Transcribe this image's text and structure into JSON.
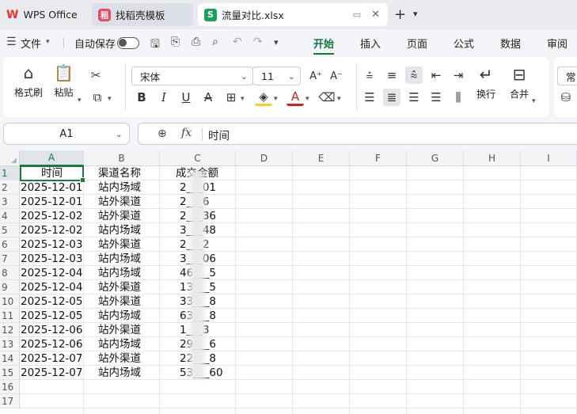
{
  "tabs": [
    {
      "label": "WPS Office",
      "icon": "wps-logo-icon"
    },
    {
      "label": "找稻壳模板",
      "icon": "docer-icon"
    },
    {
      "label": "流量对比.xlsx",
      "icon": "spreadsheet-icon"
    }
  ],
  "tab_icons": {
    "wps": "W",
    "docer": "稻",
    "sheet": "S",
    "new": "+",
    "dropdown": "⌄",
    "close": "✕",
    "monitor": "▭"
  },
  "menu": {
    "file_label": "文件",
    "autosave_label": "自动保存",
    "tabs": [
      "开始",
      "插入",
      "页面",
      "公式",
      "数据",
      "审阅"
    ],
    "active_tab": "开始"
  },
  "ribbon": {
    "format_painter": "格式刷",
    "paste": "粘贴",
    "font_name": "宋体",
    "font_size": "11",
    "wrap": "换行",
    "merge": "合并",
    "more": "常"
  },
  "formula_bar": {
    "cell_ref": "A1",
    "fx": "fx",
    "value": "时间"
  },
  "columns": [
    "A",
    "B",
    "C",
    "D",
    "E",
    "F",
    "G",
    "H",
    "I"
  ],
  "rows": [
    "1",
    "2",
    "3",
    "4",
    "5",
    "6",
    "7",
    "8",
    "9",
    "10",
    "11",
    "12",
    "13",
    "14",
    "15",
    "16",
    "17"
  ],
  "table": {
    "header": [
      "时间",
      "渠道名称",
      "成交金额"
    ],
    "rows": [
      [
        "2025-12-01",
        "站内场域",
        "2___01"
      ],
      [
        "2025-12-01",
        "站外渠道",
        "2___6"
      ],
      [
        "2025-12-02",
        "站外渠道",
        "2___36"
      ],
      [
        "2025-12-02",
        "站内场域",
        "3___48"
      ],
      [
        "2025-12-03",
        "站外渠道",
        "2___2"
      ],
      [
        "2025-12-03",
        "站内场域",
        "3___06"
      ],
      [
        "2025-12-04",
        "站内场域",
        "46___5"
      ],
      [
        "2025-12-04",
        "站外渠道",
        "13___5"
      ],
      [
        "2025-12-05",
        "站外渠道",
        "33___8"
      ],
      [
        "2025-12-05",
        "站内场域",
        "63___8"
      ],
      [
        "2025-12-06",
        "站外渠道",
        "1___3"
      ],
      [
        "2025-12-06",
        "站内场域",
        "29___6"
      ],
      [
        "2025-12-07",
        "站外渠道",
        "22___8"
      ],
      [
        "2025-12-07",
        "站内场域",
        "53___60"
      ]
    ]
  },
  "colors": {
    "accent": "#117a3d",
    "selection": "#1a7a42",
    "wps_red": "#e8312e"
  }
}
